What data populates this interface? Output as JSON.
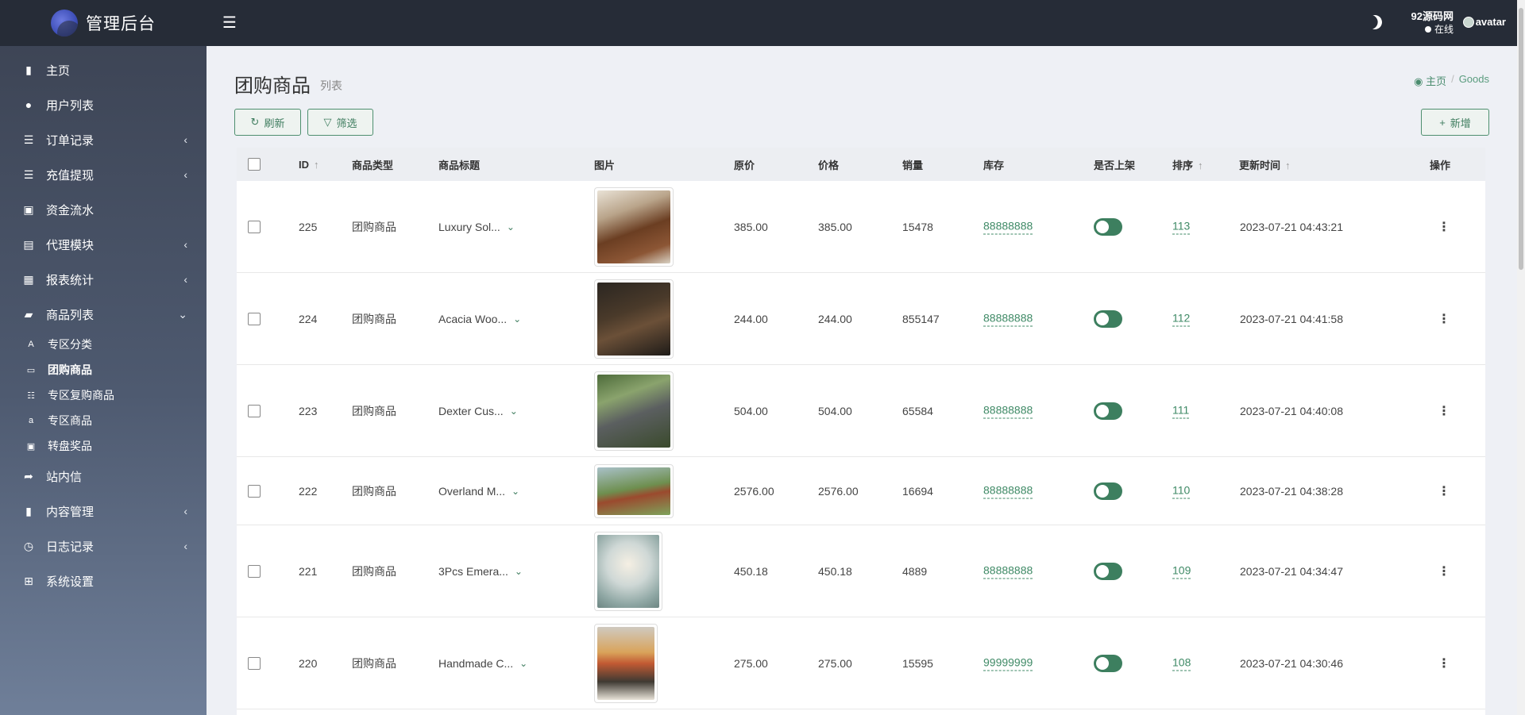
{
  "brand": {
    "title": "管理后台"
  },
  "topbar": {
    "username": "92源码网",
    "status": "在线",
    "avatar_alt": "avatar"
  },
  "sidebar": {
    "items": [
      {
        "label": "主页",
        "icon": "bar-chart-icon"
      },
      {
        "label": "用户列表",
        "icon": "user-icon"
      },
      {
        "label": "订单记录",
        "icon": "list-icon",
        "has_children": true
      },
      {
        "label": "充值提现",
        "icon": "list-icon",
        "has_children": true
      },
      {
        "label": "资金流水",
        "icon": "money-icon"
      },
      {
        "label": "代理模块",
        "icon": "contact-icon",
        "has_children": true
      },
      {
        "label": "报表统计",
        "icon": "calendar-icon",
        "has_children": true
      },
      {
        "label": "商品列表",
        "icon": "cubes-icon",
        "expanded": true
      },
      {
        "label": "站内信",
        "icon": "share-icon"
      },
      {
        "label": "内容管理",
        "icon": "bookmark-icon",
        "has_children": true
      },
      {
        "label": "日志记录",
        "icon": "clock-icon",
        "has_children": true
      },
      {
        "label": "系统设置",
        "icon": "windows-icon"
      }
    ],
    "submenu": [
      {
        "label": "专区分类",
        "icon": "font-icon"
      },
      {
        "label": "团购商品",
        "icon": "group-icon",
        "active": true
      },
      {
        "label": "专区复购商品",
        "icon": "th-list-icon"
      },
      {
        "label": "专区商品",
        "icon": "amazon-icon"
      },
      {
        "label": "转盘奖品",
        "icon": "money-icon"
      }
    ]
  },
  "page": {
    "title": "团购商品",
    "subtitle": "列表",
    "breadcrumb_home": "主页",
    "breadcrumb_sep": "/",
    "breadcrumb_current": "Goods"
  },
  "toolbar": {
    "refresh": "刷新",
    "filter": "筛选",
    "add": "新增"
  },
  "table": {
    "headers": {
      "id": "ID",
      "type": "商品类型",
      "title": "商品标题",
      "image": "图片",
      "original_price": "原价",
      "price": "价格",
      "sales": "销量",
      "stock": "库存",
      "on_shelf": "是否上架",
      "sort": "排序",
      "updated": "更新时间",
      "actions": "操作"
    },
    "rows": [
      {
        "id": "225",
        "type": "团购商品",
        "title": "Luxury Sol...",
        "original_price": "385.00",
        "price": "385.00",
        "sales": "15478",
        "stock": "88888888",
        "on_shelf": true,
        "sort": "113",
        "updated": "2023-07-21 04:43:21"
      },
      {
        "id": "224",
        "type": "团购商品",
        "title": "Acacia Woo...",
        "original_price": "244.00",
        "price": "244.00",
        "sales": "855147",
        "stock": "88888888",
        "on_shelf": true,
        "sort": "112",
        "updated": "2023-07-21 04:41:58"
      },
      {
        "id": "223",
        "type": "团购商品",
        "title": "Dexter Cus...",
        "original_price": "504.00",
        "price": "504.00",
        "sales": "65584",
        "stock": "88888888",
        "on_shelf": true,
        "sort": "111",
        "updated": "2023-07-21 04:40:08"
      },
      {
        "id": "222",
        "type": "团购商品",
        "title": "Overland M...",
        "original_price": "2576.00",
        "price": "2576.00",
        "sales": "16694",
        "stock": "88888888",
        "on_shelf": true,
        "sort": "110",
        "updated": "2023-07-21 04:38:28"
      },
      {
        "id": "221",
        "type": "团购商品",
        "title": "3Pcs Emera...",
        "original_price": "450.18",
        "price": "450.18",
        "sales": "4889",
        "stock": "88888888",
        "on_shelf": true,
        "sort": "109",
        "updated": "2023-07-21 04:34:47"
      },
      {
        "id": "220",
        "type": "团购商品",
        "title": "Handmade C...",
        "original_price": "275.00",
        "price": "275.00",
        "sales": "15595",
        "stock": "99999999",
        "on_shelf": true,
        "sort": "108",
        "updated": "2023-07-21 04:30:46"
      }
    ]
  }
}
